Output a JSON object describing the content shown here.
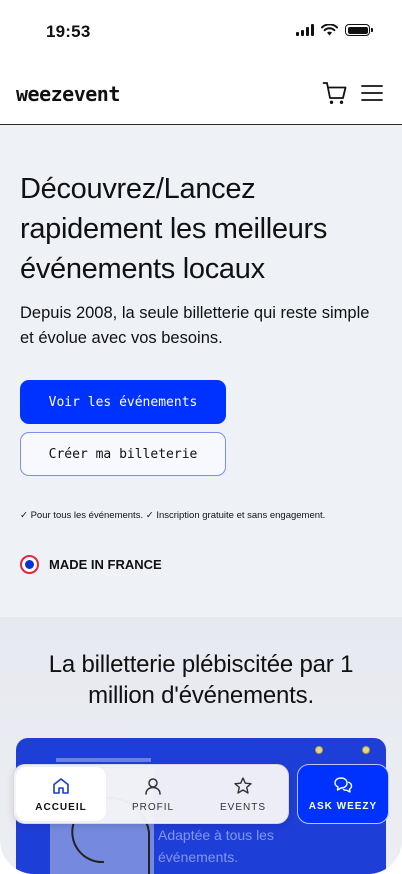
{
  "status_bar": {
    "time": "19:53"
  },
  "header": {
    "logo": "weezevent",
    "cart_icon": "cart-icon",
    "menu_icon": "hamburger-menu-icon"
  },
  "hero": {
    "title": "Découvrez/Lancez rapidement les meilleurs événements locaux",
    "lead": "Depuis 2008, la seule billetterie qui reste simple et évolue avec vos besoins.",
    "primary_cta": "Voir les événements",
    "secondary_cta": "Créer ma billeterie",
    "checks": "✓ Pour tous les événements. ✓ Inscription gratuite et sans engagement.",
    "made_in_france": "MADE IN FRANCE"
  },
  "section2": {
    "title": "La billetterie plébiscitée par 1 million d'événements.",
    "card_text": "Adaptée à tous les événements."
  },
  "bottom_nav": {
    "items": [
      {
        "label": "ACCUEIL",
        "icon": "home-icon",
        "active": true
      },
      {
        "label": "PROFIL",
        "icon": "user-icon",
        "active": false
      },
      {
        "label": "EVENTS",
        "icon": "star-icon",
        "active": false
      }
    ],
    "ask_label": "ASK WEEZY",
    "ask_icon": "chat-bubbles-icon"
  },
  "colors": {
    "accent": "#0032ff",
    "hero_bg": "#eef2f7",
    "france_red": "#e8243a",
    "france_blue": "#0b2fd6"
  }
}
